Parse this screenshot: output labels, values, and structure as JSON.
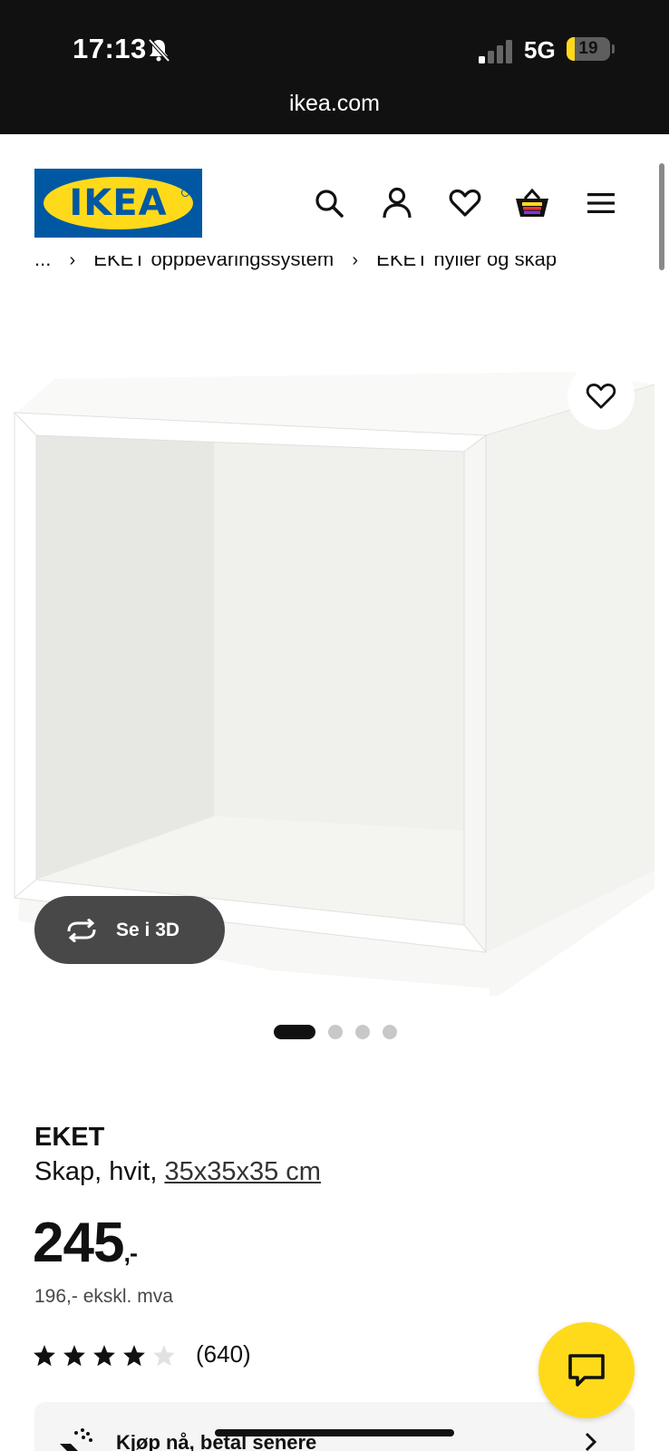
{
  "status_bar": {
    "time": "17:13",
    "network": "5G",
    "battery": "19",
    "battery_level": 0.19
  },
  "browser": {
    "url": "ikea.com"
  },
  "header": {
    "logo_text": "IKEA",
    "icons": [
      "search-icon",
      "account-icon",
      "favourites-icon",
      "cart-icon",
      "menu-icon"
    ]
  },
  "breadcrumb": {
    "ellipsis": "...",
    "items": [
      "EKET oppbevaringssystem",
      "EKET hyller og skap"
    ]
  },
  "media": {
    "view_3d_label": "Se i 3D",
    "slide_count": 4,
    "active_slide": 1
  },
  "product": {
    "name": "EKET",
    "description": "Skap, hvit, ",
    "size": "35x35x35 cm",
    "price": "245",
    "price_suffix": ",-",
    "price_ex_vat": "196,- ekskl. mva",
    "rating": 4,
    "rating_max": 5,
    "review_count": "(640)"
  },
  "promo": {
    "pay_later": "Kjøp nå, betal senere"
  },
  "colors": {
    "brand_blue": "#0058a3",
    "brand_yellow": "#ffda1a",
    "text": "#111111"
  }
}
